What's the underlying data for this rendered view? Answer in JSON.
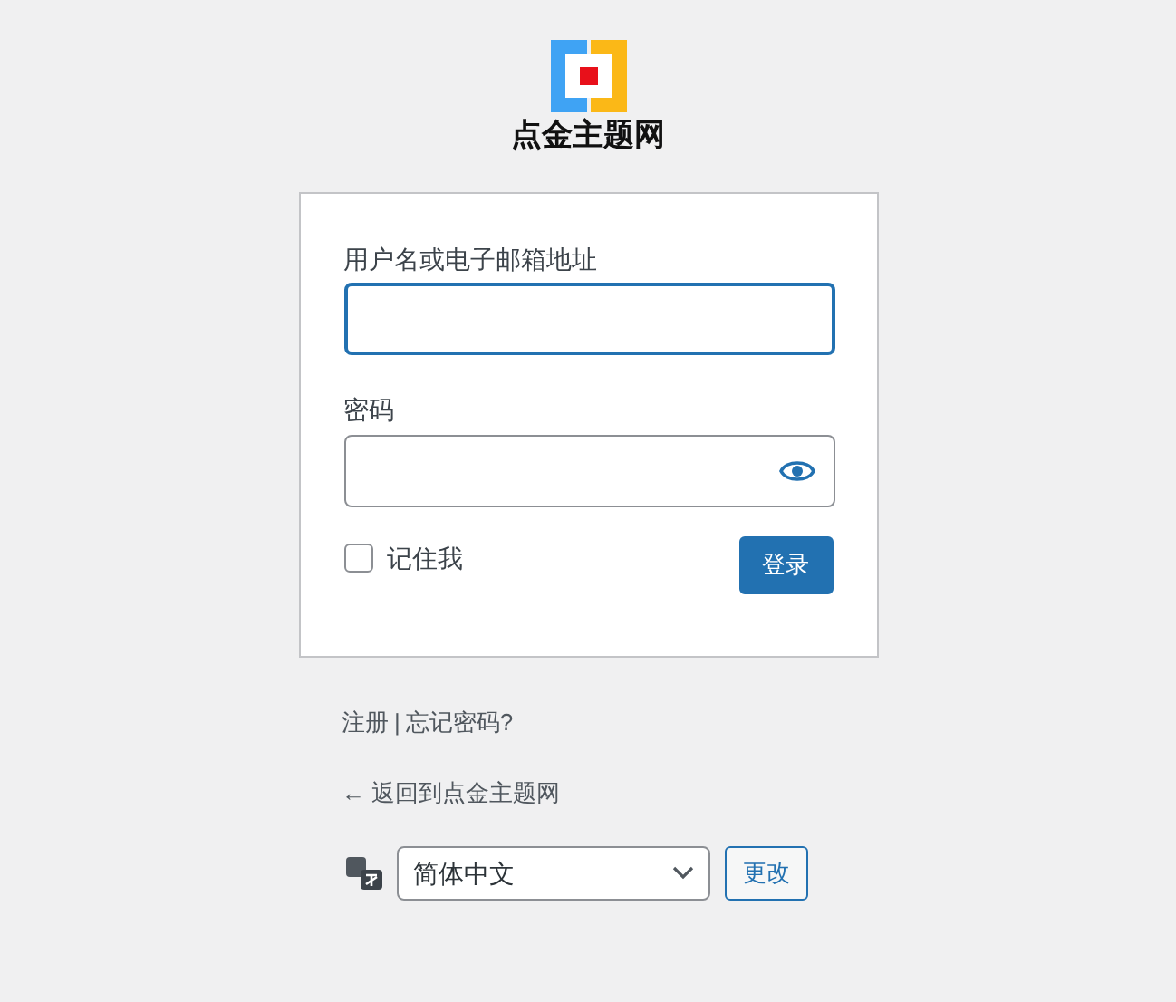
{
  "logo": {
    "text": "点金主题网"
  },
  "form": {
    "username": {
      "label": "用户名或电子邮箱地址",
      "focused": true
    },
    "password": {
      "label": "密码"
    },
    "remember": {
      "label": "记住我",
      "checked": false
    },
    "submit": "登录"
  },
  "links": [
    {
      "text": "注册"
    },
    {
      "text": "忘记密码?"
    }
  ],
  "separator": "|",
  "back_link": "← 返回到点金主题网",
  "language": {
    "value": "简体中文",
    "button": "更改"
  }
}
